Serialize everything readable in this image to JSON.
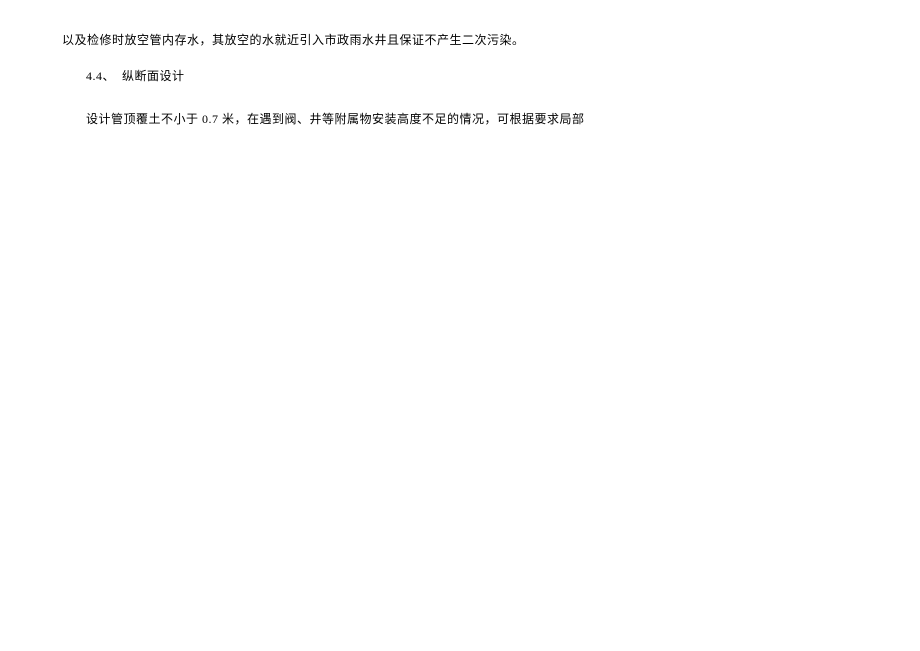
{
  "document": {
    "line1": "以及检修时放空管内存水，其放空的水就近引入市政雨水井且保证不产生二次污染。",
    "section_number": "4.4",
    "section_sep": "、",
    "section_title": "纵断面设计",
    "line3_part1": "设计管顶覆土不小于 ",
    "line3_num": "0.7",
    "line3_part2": " 米，在遇到阀、井等附属物安装高度不足的情况，可根据要求局部"
  }
}
